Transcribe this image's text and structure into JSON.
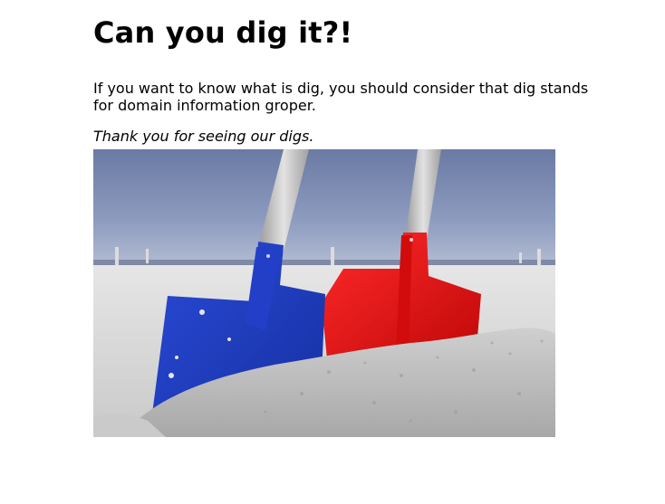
{
  "heading": "Can you dig it?!",
  "intro": "If you want to know what is dig, you should consider that dig stands for domain information groper.",
  "thanks": "Thank you for seeing our digs.",
  "image": {
    "subject": "two-shovels-in-sand-photo",
    "colors": {
      "sky_top": "#6f7fa8",
      "sky_bottom": "#a9b3cc",
      "sand": "#d4d4d4",
      "blue_shovel": "#1f3fc4",
      "red_shovel": "#f01010",
      "handle": "#c9c9c9"
    }
  }
}
